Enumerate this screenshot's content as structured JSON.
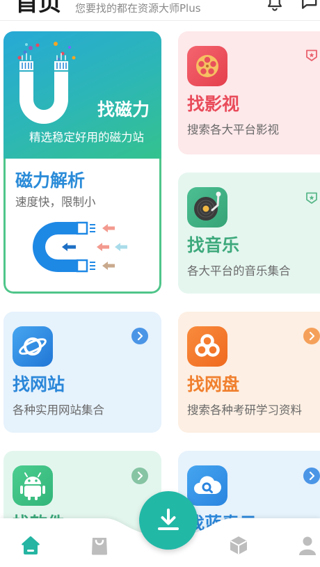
{
  "header": {
    "title": "首页",
    "subtitle": "您要找的都在资源大师Plus",
    "icons": [
      "bell-icon",
      "chat-icon"
    ]
  },
  "magnet_card": {
    "title": "找磁力",
    "subtitle": "精选稳定好用的磁力站",
    "parse_title": "磁力解析",
    "parse_subtitle": "速度快，限制小",
    "gradient_from": "#27a9d6",
    "gradient_to": "#34c28e",
    "border_color": "#4fc58a",
    "parse_title_color": "#2a8bd8",
    "illustration": "magnet-icon",
    "parse_illustration": "magnet-arrows-icon"
  },
  "cards": [
    {
      "title": "找影视",
      "subtitle": "搜索各大平台影视",
      "icon": "film-reel-icon",
      "badge": "ribbon-badge-icon",
      "accent": "#e94b5a",
      "bg": "#fde8ea"
    },
    {
      "title": "找音乐",
      "subtitle": "各大平台的音乐集合",
      "icon": "record-player-icon",
      "badge": "ribbon-badge-icon",
      "accent": "#3ea97c",
      "bg": "#e5f6ef"
    },
    {
      "title": "找网站",
      "subtitle": "各种实用网站集合",
      "icon": "planet-icon",
      "chevron": "chevron-right-icon",
      "accent": "#2b87d9",
      "bg": "#e6f2fc",
      "chevron_color": "#4b95e6"
    },
    {
      "title": "找网盘",
      "subtitle": "搜索各种考研学习资料",
      "icon": "cloud-disk-icon",
      "chevron": "chevron-right-icon",
      "accent": "#f07f2e",
      "bg": "#fdefe3",
      "chevron_color": "#f5a05a"
    },
    {
      "title": "找软件",
      "icon": "android-icon",
      "chevron": "chevron-right-icon",
      "accent": "#3ea97c",
      "bg": "#e3f6ee",
      "chevron_color": "#86c4a4"
    },
    {
      "title": "找蓝奏云",
      "icon": "cloud-search-icon",
      "chevron": "chevron-right-icon",
      "accent": "#2b87d9",
      "bg": "#e6f2fc",
      "chevron_color": "#4b95e6"
    }
  ],
  "bottom_nav": {
    "items": [
      {
        "icon": "home-icon",
        "active": true
      },
      {
        "icon": "bag-icon",
        "active": false
      },
      {
        "icon": "cube-icon",
        "active": false
      },
      {
        "icon": "person-icon",
        "active": false
      }
    ],
    "fab_icon": "download-icon",
    "fab_color": "#22b8a6",
    "active_color": "#25b5a2",
    "inactive_color": "#bdbdbd"
  }
}
